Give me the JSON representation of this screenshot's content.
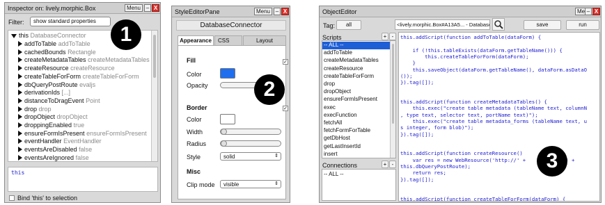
{
  "inspector": {
    "title": "Inspector on: lively.morphic.Box",
    "menu_label": "Menu",
    "min_label": "–",
    "close_label": "X",
    "filter_label": "Filter:",
    "filter_value": "show standard properties",
    "root": {
      "name": "this",
      "value": "DatabaseConnector"
    },
    "rows": [
      {
        "name": "addToTable",
        "value": "addToTable"
      },
      {
        "name": "cachedBounds",
        "value": "Rectangle"
      },
      {
        "name": "createMetadataTables",
        "value": "createMetadataTables"
      },
      {
        "name": "createResource",
        "value": "createResource"
      },
      {
        "name": "createTableForForm",
        "value": "createTableForForm"
      },
      {
        "name": "dbQueryPostRoute",
        "value": "evaljs"
      },
      {
        "name": "derivationIds",
        "value": "[...]"
      },
      {
        "name": "distanceToDragEvent",
        "value": "Point"
      },
      {
        "name": "drop",
        "value": "drop"
      },
      {
        "name": "dropObject",
        "value": "dropObject"
      },
      {
        "name": "droppingEnabled",
        "value": "true"
      },
      {
        "name": "ensureFormIsPresent",
        "value": "ensureFormIsPresent"
      },
      {
        "name": "eventHandler",
        "value": "EventHandler"
      },
      {
        "name": "eventsAreDisabled",
        "value": "false"
      },
      {
        "name": "eventsAreIgnored",
        "value": "false"
      }
    ],
    "eval_text": "this",
    "bind_label": "Bind 'this' to selection",
    "badge": "1"
  },
  "style_editor": {
    "title": "StyleEditorPane",
    "menu_label": "Menu",
    "min_label": "–",
    "close_label": "X",
    "target_name": "DatabaseConnector",
    "tabs": [
      "Appearance",
      "CSS",
      "Layout"
    ],
    "fill_header": "Fill",
    "color_label": "Color",
    "opacity_label": "Opacity",
    "border_header": "Border",
    "border_color_label": "Color",
    "width_label": "Width",
    "radius_label": "Radius",
    "style_label": "Style",
    "style_value": "solid",
    "misc_header": "Misc",
    "clip_label": "Clip mode",
    "clip_value": "visible",
    "fill_color": "#1f6ef0",
    "border_color": "#ffffff",
    "badge": "2"
  },
  "object_editor": {
    "title": "ObjectEditor",
    "menu_label": "Menu",
    "min_label": "–",
    "close_label": "X",
    "tag_label": "Tag:",
    "tag_value": "all",
    "target_field": "<lively.morphic.Box#A13A5... - DatabaseConn",
    "save_label": "save",
    "run_label": "run",
    "scripts_header": "Scripts",
    "plus": "+",
    "minus": "-",
    "scripts": [
      "-- ALL --",
      "addToTable",
      "createMetadataTables",
      "createResource",
      "createTableForForm",
      "drop",
      "dropObject",
      "ensureFormIsPresent",
      "exec",
      "execFunction",
      "fetchAll",
      "fetchFormForTable",
      "getDbHost",
      "getLastInsertId",
      "insert"
    ],
    "connections_header": "Connections",
    "connections": [
      "-- ALL --"
    ],
    "code_lines": [
      "this.addScript(function addToTable(dataForm) {",
      "",
      "    if (!this.tableExists(dataForm.getTableName())) {",
      "        this.createTableForForm(dataForm);",
      "    }",
      "    this.saveObject(dataForm.getTableName(), dataForm.asDataO",
      "());",
      "}).tag([]);",
      "",
      "",
      "this.addScript(function createMetadataTables() {",
      "    this.exec(\"create table metadata (tableName text, columnN",
      ", type text, selector text, portName text)\");",
      "    this.exec(\"create table metadata_forms (tableName text, u",
      "s integer, form blob)\");",
      "}).tag([]);",
      "",
      "",
      "this.addScript(function createResource()",
      "    var res = new WebResource('http://' +         ost() +",
      "this.dbQueryPostRoute);",
      "    return res;",
      "}).tag([]);",
      "",
      "",
      "this.addScript(function createTableForForm(dataForm) {"
    ],
    "badge": "3"
  }
}
